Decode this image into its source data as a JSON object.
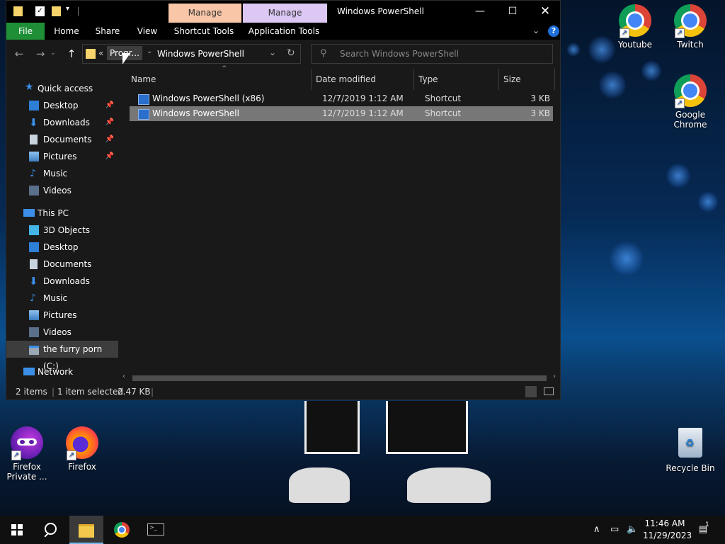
{
  "desktop": {
    "icons": [
      {
        "label": "Youtube"
      },
      {
        "label": "Twitch"
      },
      {
        "label": "Google Chrome"
      },
      {
        "label": "Firefox Private ..."
      },
      {
        "label": "Firefox"
      },
      {
        "label": "Recycle Bin"
      }
    ]
  },
  "window": {
    "title": "Windows PowerShell",
    "context_tabs": [
      {
        "label": "Manage",
        "color": "#f9c7a8"
      },
      {
        "label": "Manage",
        "color": "#dcc7f5"
      }
    ],
    "ribbon_tabs": [
      "File",
      "Home",
      "Share",
      "View",
      "Shortcut Tools",
      "Application Tools"
    ],
    "address": {
      "crumbs_collapsed": "«",
      "parent": "Progr...",
      "current": "Windows PowerShell"
    },
    "search_placeholder": "Search Windows PowerShell",
    "sidebar": {
      "quick_access": "Quick access",
      "quick_items": [
        "Desktop",
        "Downloads",
        "Documents",
        "Pictures",
        "Music",
        "Videos"
      ],
      "this_pc": "This PC",
      "pc_items": [
        "3D Objects",
        "Desktop",
        "Documents",
        "Downloads",
        "Music",
        "Pictures",
        "Videos",
        "the furry porn (C:)"
      ],
      "network": "Network"
    },
    "columns": [
      "Name",
      "Date modified",
      "Type",
      "Size"
    ],
    "files": [
      {
        "name": "Windows PowerShell (x86)",
        "date": "12/7/2019 1:12 AM",
        "type": "Shortcut",
        "size": "3 KB",
        "selected": false
      },
      {
        "name": "Windows PowerShell",
        "date": "12/7/2019 1:12 AM",
        "type": "Shortcut",
        "size": "3 KB",
        "selected": true
      }
    ],
    "status": {
      "count": "2 items",
      "selected": "1 item selected",
      "size": "2.47 KB"
    }
  },
  "taskbar": {
    "clock_time": "11:46 AM",
    "clock_date": "11/29/2023",
    "notification_count": "1"
  }
}
